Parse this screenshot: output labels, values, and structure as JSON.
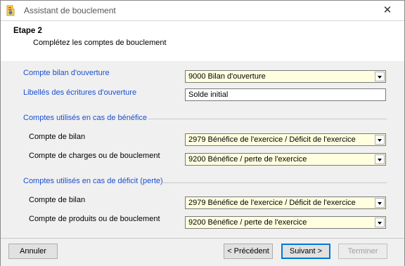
{
  "window": {
    "title": "Assistant de bouclement",
    "close_glyph": "✕"
  },
  "header": {
    "step": "Etape 2",
    "subtitle": "Complétez les comptes de bouclement"
  },
  "form": {
    "opening_account_label": "Compte bilan d'ouverture",
    "opening_account_value": "9000 Bilan d'ouverture",
    "opening_text_label": "Libellés des écritures d'ouverture",
    "opening_text_value": "Solde initial",
    "profit_section": "Comptes utilisés en cas de bénéfice",
    "profit_balance_label": "Compte de bilan",
    "profit_balance_value": "2979 Bénéfice de l'exercice / Déficit de l'exercice",
    "profit_closing_label": "Compte de charges ou de bouclement",
    "profit_closing_value": "9200 Bénéfice / perte de l'exercice",
    "loss_section": "Comptes utilisés en cas de déficit (perte)",
    "loss_balance_label": "Compte de bilan",
    "loss_balance_value": "2979 Bénéfice de l'exercice / Déficit de l'exercice",
    "loss_closing_label": "Compte de produits ou de bouclement",
    "loss_closing_value": "9200 Bénéfice / perte de l'exercice"
  },
  "buttons": {
    "cancel": "Annuler",
    "previous": "< Précédent",
    "next": "Suivant >",
    "finish": "Terminer"
  },
  "colors": {
    "label_blue": "#1a4fd0",
    "combo_bg": "#ffffe0",
    "body_bg": "#f0f0f0"
  }
}
